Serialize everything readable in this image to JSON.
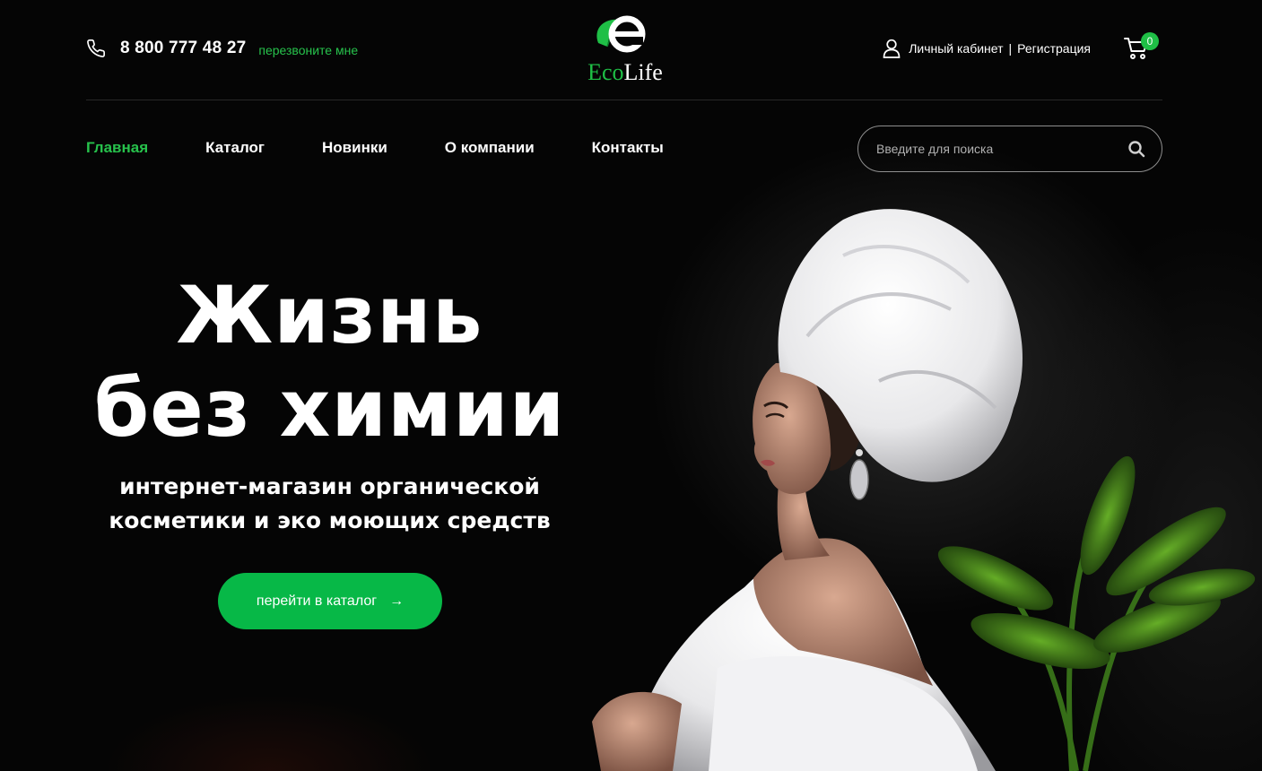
{
  "header": {
    "phone": "8 800 777 48 27",
    "callback_label": "перезвоните мне",
    "logo": {
      "eco": "Eco",
      "life": "Life"
    },
    "account_label": "Личный кабинет",
    "separator": "|",
    "register_label": "Регистрация",
    "cart_count": "0"
  },
  "nav": {
    "items": [
      {
        "label": "Главная",
        "active": true
      },
      {
        "label": "Каталог"
      },
      {
        "label": "Новинки"
      },
      {
        "label": "О компании"
      },
      {
        "label": "Контакты"
      }
    ]
  },
  "search": {
    "placeholder": "Введите для поиска"
  },
  "hero": {
    "title_line1": "Жизнь",
    "title_line2": "без химии",
    "subtitle_line1": "интернет-магазин органической",
    "subtitle_line2": "косметики и эко моющих средств",
    "cta_label": "перейти в каталог",
    "cta_arrow": "→"
  },
  "colors": {
    "accent": "#27c24c",
    "button": "#07b847",
    "background": "#050505"
  },
  "icons": [
    "phone-icon",
    "user-icon",
    "cart-icon",
    "search-icon",
    "logo-leaf-icon"
  ]
}
